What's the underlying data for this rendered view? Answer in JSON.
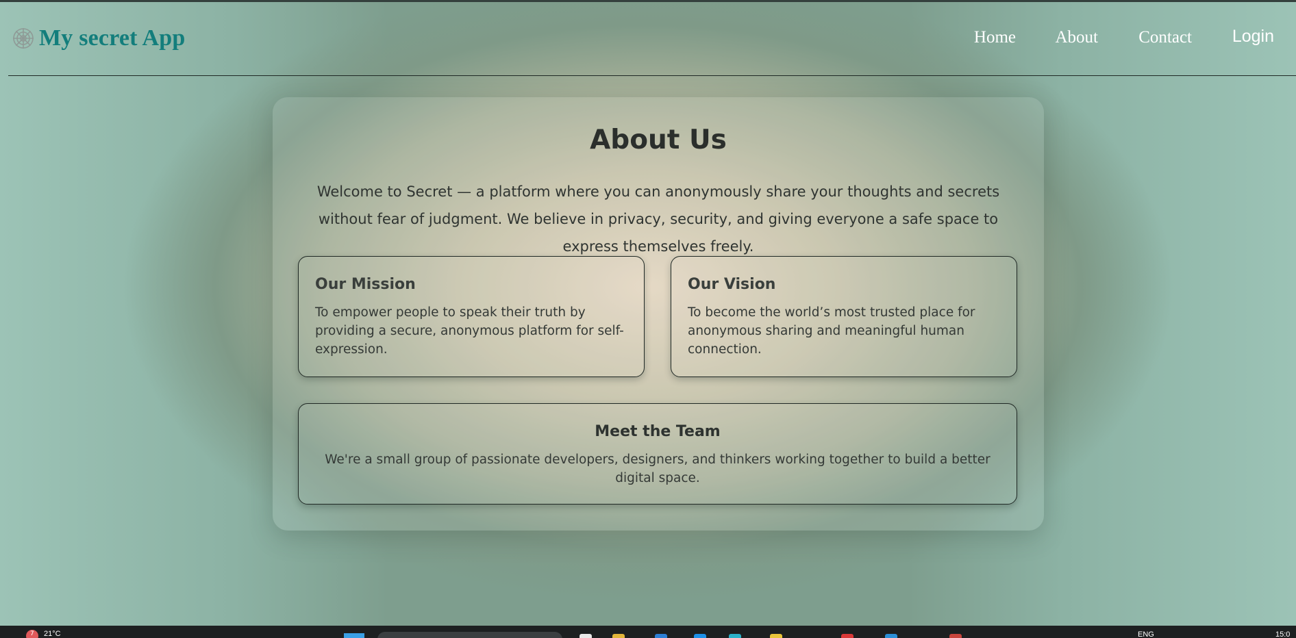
{
  "header": {
    "brand_title": "My secret App",
    "brand_icon": "spiderweb-icon",
    "nav": [
      {
        "label": "Home"
      },
      {
        "label": "About"
      },
      {
        "label": "Contact"
      },
      {
        "label": "Login"
      }
    ]
  },
  "about": {
    "title": "About Us",
    "intro": "Welcome to Secret — a platform where you can anonymously share your thoughts and secrets without fear of judgment. We believe in privacy, security, and giving everyone a safe space to express themselves freely.",
    "mission": {
      "heading": "Our Mission",
      "text": "To empower people to speak their truth by providing a secure, anonymous platform for self-expression."
    },
    "vision": {
      "heading": "Our Vision",
      "text": "To become the world’s most trusted place for anonymous sharing and meaningful human connection."
    },
    "team": {
      "heading": "Meet the Team",
      "text": "We're a small group of passionate developers, designers, and thinkers working together to build a better digital space."
    }
  },
  "taskbar": {
    "weather_badge": "7",
    "temperature": "21°C",
    "language": "ENG",
    "time": "15:0"
  },
  "colors": {
    "brand": "#137e7c",
    "nav_text": "#ffffff",
    "heading_text": "#2b2f2c"
  }
}
